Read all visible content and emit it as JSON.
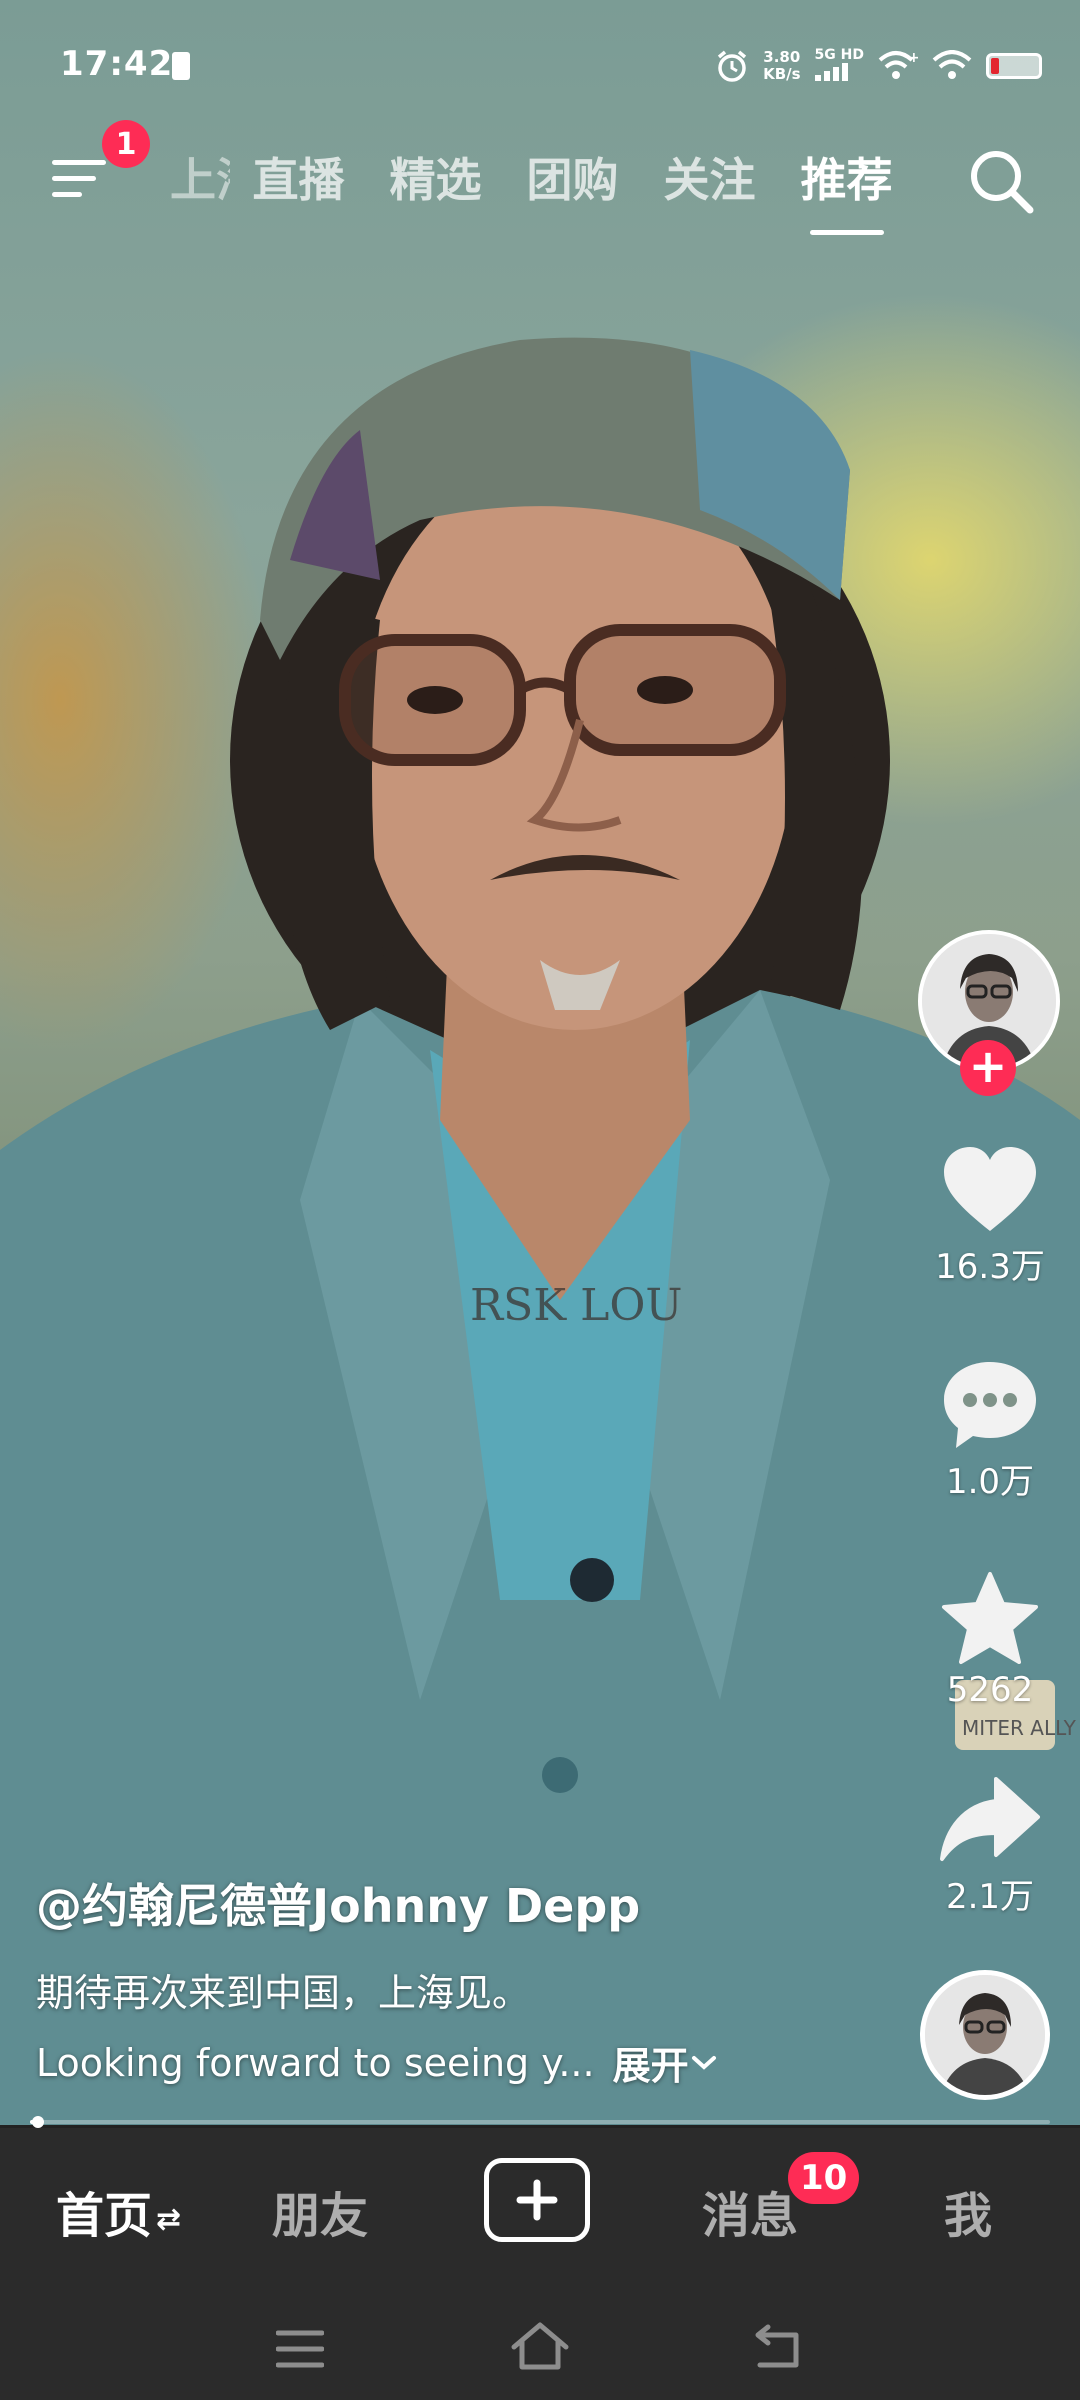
{
  "status_bar": {
    "time": "17:42",
    "net_speed_value": "3.80",
    "net_speed_unit": "KB/s",
    "network_type": "5G HD"
  },
  "top_nav": {
    "menu_badge": "1",
    "tabs": [
      {
        "label": "上海"
      },
      {
        "label": "直播"
      },
      {
        "label": "精选"
      },
      {
        "label": "团购"
      },
      {
        "label": "关注"
      },
      {
        "label": "推荐"
      }
    ],
    "active_tab": "推荐"
  },
  "actions": {
    "follow_symbol": "+",
    "like_count": "16.3万",
    "comment_count": "1.0万",
    "favorite_count": "5262",
    "share_count": "2.1万"
  },
  "caption": {
    "author": "@约翰尼德普Johnny Depp",
    "line1": "期待再次来到中国，上海见。",
    "line2": "Looking forward to seeing y...",
    "expand_label": "展开"
  },
  "progress": {
    "played_fraction": 0.008
  },
  "bottom_nav": {
    "home": "首页",
    "friends": "朋友",
    "messages": "消息",
    "messages_badge": "10",
    "me": "我"
  },
  "colors": {
    "accent_red": "#fe2c55",
    "nav_background": "#2b2b2b"
  }
}
